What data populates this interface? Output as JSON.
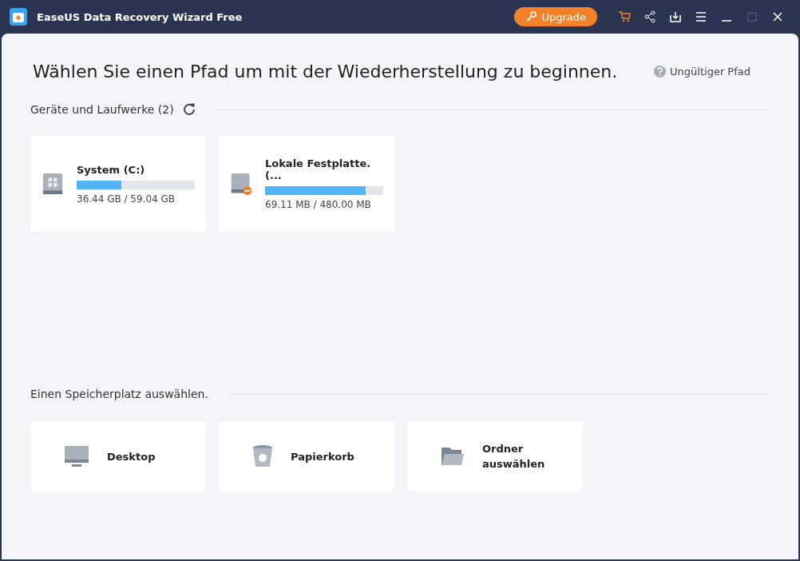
{
  "window": {
    "title": "EaseUS Data Recovery Wizard Free",
    "upgrade": "Upgrade"
  },
  "heading": "Wählen Sie einen Pfad um mit der Wiederherstellung zu beginnen.",
  "invalid_path": "Ungültiger Pfad",
  "devices": {
    "title": "Geräte und Laufwerke (2)",
    "drives": [
      {
        "name": "System (C:)",
        "kind": "system",
        "usage": "36.44 GB / 59.04 GB",
        "level": 0.38
      },
      {
        "name": "Lokale Festplatte. (...",
        "kind": "error",
        "usage": "69.11 MB / 480.00 MB",
        "level": 0.85
      }
    ]
  },
  "locations": {
    "title": "Einen Speicherplatz auswählen.",
    "items": [
      {
        "label": "Desktop",
        "kind": "desktop"
      },
      {
        "label": "Papierkorb",
        "kind": "trash"
      },
      {
        "label": "Ordner auswählen",
        "kind": "folder"
      }
    ]
  }
}
